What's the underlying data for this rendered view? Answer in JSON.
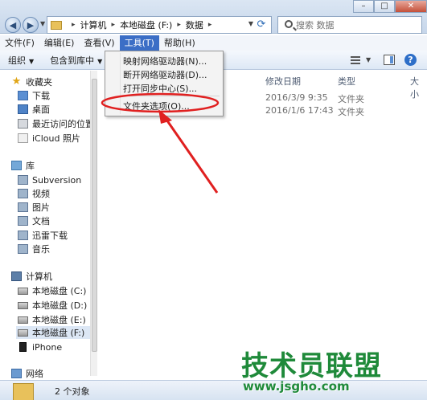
{
  "address": {
    "crumbs": [
      "计算机",
      "本地磁盘 (F:)",
      "数据"
    ]
  },
  "search": {
    "placeholder": "搜索 数据"
  },
  "menubar": [
    "文件(F)",
    "编辑(E)",
    "查看(V)",
    "工具(T)",
    "帮助(H)"
  ],
  "toolbar": {
    "organize": "组织",
    "include": "包含到库中"
  },
  "tools_menu": {
    "items": [
      "映射网络驱动器(N)...",
      "断开网络驱动器(D)...",
      "打开同步中心(S)...",
      "文件夹选项(O)..."
    ]
  },
  "nav": {
    "favorites": "收藏夹",
    "downloads": "下载",
    "desktop": "桌面",
    "recent": "最近访问的位置",
    "icloud": "iCloud 照片",
    "libraries": "库",
    "subversion": "Subversion",
    "videos": "视频",
    "pictures": "图片",
    "documents": "文档",
    "thunder": "迅雷下载",
    "music": "音乐",
    "computer": "计算机",
    "drive_c": "本地磁盘 (C:)",
    "drive_d": "本地磁盘 (D:)",
    "drive_e": "本地磁盘 (E:)",
    "drive_f": "本地磁盘 (F:)",
    "iphone": "iPhone",
    "network": "网络"
  },
  "columns": {
    "modified": "修改日期",
    "type": "类型",
    "size": "大小"
  },
  "rows": [
    {
      "modified": "2016/3/9 9:35",
      "type": "文件夹"
    },
    {
      "modified": "2016/1/6 17:43",
      "type": "文件夹"
    }
  ],
  "status": {
    "count": "2 个对象"
  },
  "watermark": {
    "title": "技术员联盟",
    "url": "www.jsgho.com"
  },
  "colors": {
    "menu_highlight": "#3b6ec6",
    "annotation": "#e02020",
    "watermark": "#1f8a3a"
  }
}
